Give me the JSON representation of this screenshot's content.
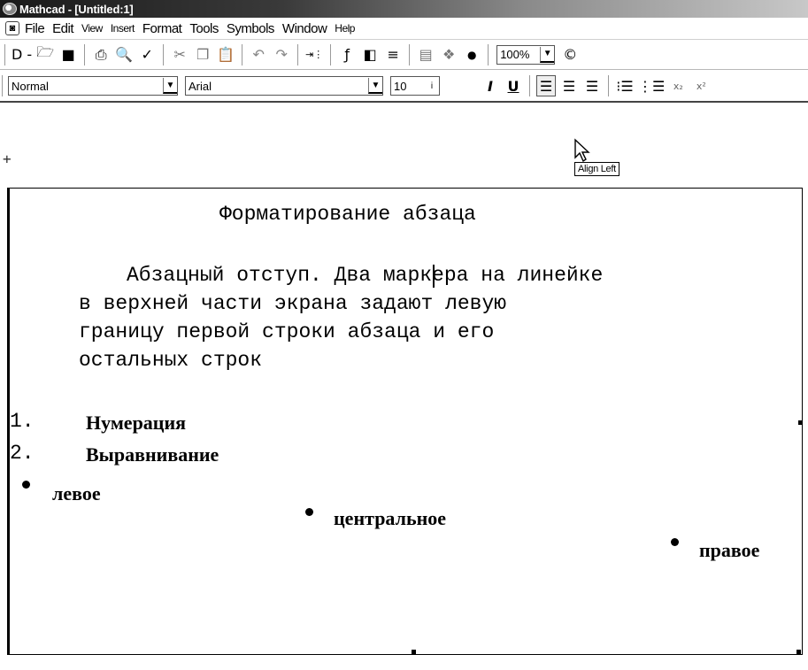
{
  "window": {
    "title": "Mathcad - [Untitled:1]"
  },
  "menu": {
    "items": [
      {
        "label": "File"
      },
      {
        "label": "Edit"
      },
      {
        "label": "View"
      },
      {
        "label": "Insert"
      },
      {
        "label": "Format"
      },
      {
        "label": "Tools"
      },
      {
        "label": "Symbols"
      },
      {
        "label": "Window"
      },
      {
        "label": "Help"
      }
    ]
  },
  "standard_toolbar": {
    "zoom_value": "100%",
    "icons": [
      "new-doc-icon",
      "open-folder-icon",
      "save-icon",
      "print-icon",
      "print-preview-icon",
      "spell-check-icon",
      "cut-icon",
      "copy-icon",
      "paste-icon",
      "undo-icon",
      "redo-icon",
      "align-icon",
      "insert-function-icon",
      "insert-unit-icon",
      "calculate-icon",
      "resource-icon",
      "component-icon",
      "help-icon"
    ]
  },
  "formatting_toolbar": {
    "style_value": "Normal",
    "font_value": "Arial",
    "size_value": "10",
    "icons": [
      "bold-icon",
      "italic-icon",
      "underline-icon",
      "align-left-icon",
      "align-center-icon",
      "align-right-icon",
      "bullets-icon",
      "numbering-icon",
      "subscript-icon",
      "superscript-icon"
    ]
  },
  "tooltip": {
    "text": "Align Left"
  },
  "document": {
    "heading": "Форматирование абзаца",
    "paragraph_lines": [
      "Абзацный отступ. Два маркера на линейке",
      "в верхней части экрана задают левую",
      "границу первой строки абзаца и его",
      "остальных строк"
    ],
    "numbered_list": [
      {
        "num": "1.",
        "text": "Нумерация"
      },
      {
        "num": "2.",
        "text": "Выравнивание"
      }
    ],
    "bullets": [
      {
        "text": "левое",
        "align": "left"
      },
      {
        "text": "центральное",
        "align": "center"
      },
      {
        "text": "правое",
        "align": "right"
      }
    ]
  }
}
